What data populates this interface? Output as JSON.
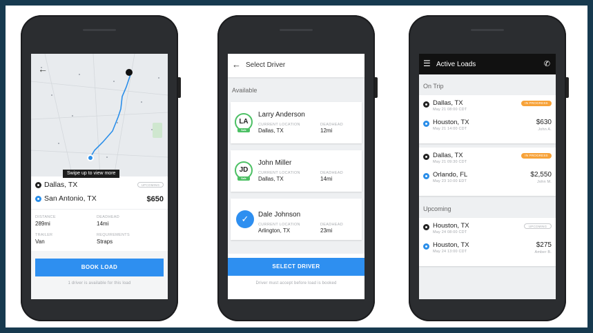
{
  "phone1": {
    "tooltip": "Swipe up to view more",
    "origin": "Dallas, TX",
    "origin_badge": "Upcoming",
    "destination": "San Antonio, TX",
    "price": "$650",
    "distance_label": "Distance",
    "distance_value": "289mi",
    "deadhead_label": "Deadhead",
    "deadhead_value": "14mi",
    "trailer_label": "Trailer",
    "trailer_value": "Van",
    "requirements_label": "Requirements",
    "requirements_value": "Straps",
    "book_button": "BOOK LOAD",
    "footer_note": "1 driver is available for this load"
  },
  "phone2": {
    "title": "Select Driver",
    "section": "Available",
    "drivers": [
      {
        "initials": "LA",
        "name": "Larry Anderson",
        "location_label": "Current Location",
        "location": "Dallas, TX",
        "deadhead_label": "Deadhead",
        "deadhead": "12mi",
        "selected": false
      },
      {
        "initials": "JD",
        "name": "John Miller",
        "location_label": "Current Location",
        "location": "Dallas, TX",
        "deadhead_label": "Deadhead",
        "deadhead": "14mi",
        "selected": false
      },
      {
        "initials": "",
        "name": "Dale Johnson",
        "location_label": "Current Location",
        "location": "Arlington, TX",
        "deadhead_label": "Deadhead",
        "deadhead": "23mi",
        "selected": true
      }
    ],
    "safe_badge": "Safe",
    "select_button": "SELECT DRIVER",
    "footer_note": "Driver must accept before load is booked"
  },
  "phone3": {
    "title": "Active Loads",
    "on_trip_label": "On Trip",
    "upcoming_label": "Upcoming",
    "on_trip": [
      {
        "origin": "Dallas, TX",
        "origin_date": "May 21 08:00 CDT",
        "badge": "In Progress",
        "destination": "Houston, TX",
        "dest_date": "May 21 14:00 CDT",
        "price": "$630",
        "driver": "John A."
      },
      {
        "origin": "Dallas, TX",
        "origin_date": "May 21 09:30 CDT",
        "badge": "In Progress",
        "destination": "Orlando, FL",
        "dest_date": "May 23 10:00 EDT",
        "price": "$2,550",
        "driver": "John M."
      }
    ],
    "upcoming": [
      {
        "origin": "Houston, TX",
        "origin_date": "May 24 08:00 CDT",
        "badge": "Upcoming",
        "destination": "Houston, TX",
        "dest_date": "May 24 13:00 CDT",
        "price": "$275",
        "driver": "Amber B."
      }
    ]
  },
  "colors": {
    "accent": "#2e8ff0",
    "safe_green": "#4cc064",
    "in_progress_orange": "#f7a238",
    "frame": "#173a4f"
  }
}
